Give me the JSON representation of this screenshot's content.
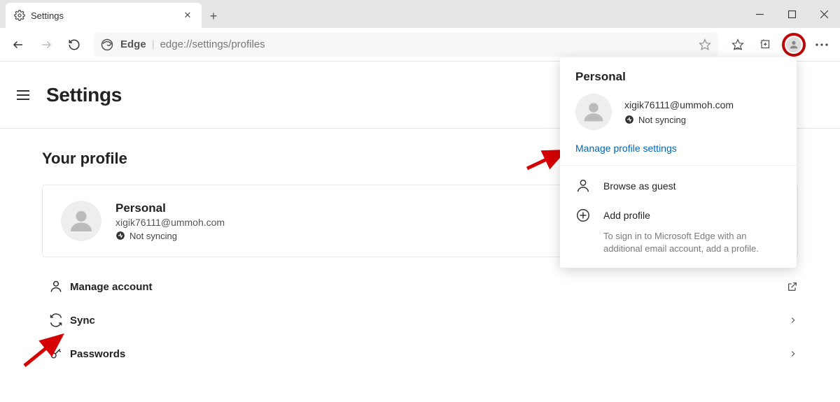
{
  "tab": {
    "title": "Settings"
  },
  "toolbar": {
    "edge_label": "Edge",
    "url": "edge://settings/profiles"
  },
  "page": {
    "title": "Settings",
    "section_title": "Your profile",
    "profile": {
      "name": "Personal",
      "email": "xigik76111@ummoh.com",
      "sync_status": "Not syncing"
    },
    "options": [
      {
        "label": "Manage account",
        "action": "external"
      },
      {
        "label": "Sync",
        "action": "chevron"
      },
      {
        "label": "Passwords",
        "action": "chevron"
      }
    ]
  },
  "popover": {
    "title": "Personal",
    "email": "xigik76111@ummoh.com",
    "sync_status": "Not syncing",
    "manage_link": "Manage profile settings",
    "rows": {
      "browse_guest": "Browse as guest",
      "add_profile": "Add profile",
      "add_profile_desc": "To sign in to Microsoft Edge with an additional email account, add a profile."
    }
  }
}
